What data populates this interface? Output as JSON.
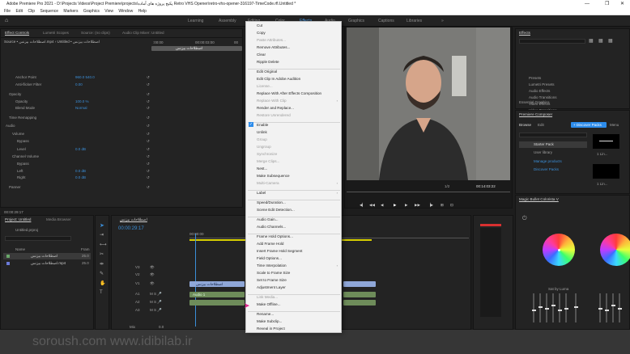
{
  "app": {
    "window_title": "Adobe Premiere Pro 2021 - D:\\Projects Videos\\Project Premiere\\projects\\پکیج پروژه های آماده Retro VHS Opener\\retro-vhs-opener-316197-TimeCode.rfl.Untitled *",
    "window_controls": [
      "—",
      "❐",
      "✕"
    ]
  },
  "menubar": [
    "File",
    "Edit",
    "Clip",
    "Sequence",
    "Markers",
    "Graphics",
    "View",
    "Window",
    "Help"
  ],
  "workspaces": [
    "Learning",
    "Assembly",
    "Editing",
    "Color",
    "Effects",
    "Audio",
    "Graphics",
    "Captions",
    "Libraries",
    "»"
  ],
  "effect_controls": {
    "tabs": [
      "Effect Controls",
      "Lumetri Scopes",
      "Source: (no clips)",
      "Audio Clip Mixer: Untitled"
    ],
    "source_line": "Source • اصطلاحات بیزنس.mp4  ›  Untitled • اصطلاحات بیزنس",
    "rows": [
      {
        "label": "Anchor Point",
        "value": "960.0    540.0"
      },
      {
        "label": "Anti-flicker Filter",
        "value": "0.00"
      },
      {
        "label": "Opacity",
        "value": ""
      },
      {
        "label": "Opacity",
        "value": "100.0 %"
      },
      {
        "label": "Blend Mode",
        "value": "Normal"
      },
      {
        "label": "Time Remapping",
        "value": ""
      },
      {
        "label": "Audio",
        "value": ""
      },
      {
        "label": "Volume",
        "value": ""
      },
      {
        "label": "Bypass",
        "value": ""
      },
      {
        "label": "Level",
        "value": "0.0 dB"
      },
      {
        "label": "Channel Volume",
        "value": ""
      },
      {
        "label": "Bypass",
        "value": ""
      },
      {
        "label": "Left",
        "value": "0.0 dB"
      },
      {
        "label": "Right",
        "value": "0.0 dB"
      },
      {
        "label": "Panner",
        "value": ""
      }
    ],
    "clip_label": "اصطلاحات بیزنس",
    "timecode": "00:00:29:17",
    "ruler_start": ":00:00",
    "ruler_mid": "00:00:03:00",
    "ruler_end": "00"
  },
  "program_monitor": {
    "timecode": "00:14:03:22",
    "fit": "1/2",
    "controls": [
      "◀▏",
      "◀◀",
      "◀",
      "▶",
      "▶",
      "▶▶",
      "▕▶",
      "⊞",
      "⊡",
      "📷",
      "⚙"
    ]
  },
  "context_menu": {
    "items": [
      {
        "label": "Cut",
        "disabled": false
      },
      {
        "label": "Copy",
        "disabled": false
      },
      {
        "label": "Paste Attributes...",
        "disabled": true
      },
      {
        "label": "Remove Attributes...",
        "disabled": false
      },
      {
        "label": "Clear",
        "disabled": false
      },
      {
        "label": "Ripple Delete",
        "disabled": false
      },
      {
        "sep": true
      },
      {
        "label": "Edit Original",
        "disabled": false
      },
      {
        "label": "Edit Clip In Adobe Audition",
        "disabled": false
      },
      {
        "label": "License...",
        "disabled": true
      },
      {
        "label": "Replace With After Effects Composition",
        "disabled": false
      },
      {
        "label": "Replace With Clip",
        "disabled": true,
        "submenu": true
      },
      {
        "label": "Render and Replace...",
        "disabled": false
      },
      {
        "label": "Restore Unrendered",
        "disabled": true
      },
      {
        "sep": true
      },
      {
        "label": "Enable",
        "disabled": false,
        "checked": true
      },
      {
        "label": "Unlink",
        "disabled": false
      },
      {
        "label": "Group",
        "disabled": true
      },
      {
        "label": "Ungroup",
        "disabled": true
      },
      {
        "label": "Synchronize",
        "disabled": true
      },
      {
        "label": "Merge Clips...",
        "disabled": true
      },
      {
        "label": "Nest...",
        "disabled": false
      },
      {
        "label": "Make Subsequence",
        "disabled": false
      },
      {
        "label": "Multi-Camera",
        "disabled": true,
        "submenu": true
      },
      {
        "sep": true
      },
      {
        "label": "Label",
        "disabled": false,
        "submenu": true
      },
      {
        "sep": true
      },
      {
        "label": "Speed/Duration...",
        "disabled": false
      },
      {
        "label": "Scene Edit Detection...",
        "disabled": false
      },
      {
        "sep": true
      },
      {
        "label": "Audio Gain...",
        "disabled": false
      },
      {
        "label": "Audio Channels...",
        "disabled": false
      },
      {
        "sep": true
      },
      {
        "label": "Frame Hold Options...",
        "disabled": false
      },
      {
        "label": "Add Frame Hold",
        "disabled": false
      },
      {
        "label": "Insert Frame Hold Segment",
        "disabled": false
      },
      {
        "label": "Field Options...",
        "disabled": false
      },
      {
        "label": "Time Interpolation",
        "disabled": false,
        "submenu": true
      },
      {
        "label": "Scale to Frame Size",
        "disabled": false
      },
      {
        "label": "Set to Frame Size",
        "disabled": false
      },
      {
        "label": "Adjustment Layer",
        "disabled": false
      },
      {
        "sep": true
      },
      {
        "label": "Link Media...",
        "disabled": true
      },
      {
        "label": "Make Offline...",
        "disabled": false
      },
      {
        "sep": true
      },
      {
        "label": "Rename...",
        "disabled": false
      },
      {
        "label": "Make Subclip...",
        "disabled": false
      },
      {
        "label": "Reveal in Project",
        "disabled": false
      }
    ]
  },
  "effects_panel": {
    "title": "Effects",
    "items": [
      "Presets",
      "Lumetri Presets",
      "Audio Effects",
      "Audio Transitions",
      "Video Effects",
      "Video Transitions"
    ],
    "footer": "Essential Graphics"
  },
  "premiere_composer": {
    "title": "Premiere Composer",
    "tabs": [
      "Browse",
      "Edit"
    ],
    "discover_button": "+ Discover Packs",
    "menu_label": "Menu",
    "tree": [
      "Starter Pack",
      "User library",
      "Manage products",
      "Discover Packs"
    ],
    "thumb_labels": [
      "1 Lin...",
      "1 Lin..."
    ]
  },
  "magic_bullet": {
    "title": "Magic Bullet Colorista V",
    "fader_label": "Sat by Luma"
  },
  "project_panel": {
    "tabs": [
      "Project: Untitled",
      "Media Browser"
    ],
    "project_file": "Untitled.prproj",
    "columns": [
      "Name",
      "Fram"
    ],
    "rows": [
      {
        "name": "اصطلاحات بیزنس",
        "fps": "25.0"
      },
      {
        "name": "اصطلاحات بیزنس.mp4",
        "fps": "25.0"
      }
    ]
  },
  "timeline": {
    "tab": "اصطلاحات بیزنس",
    "timecode": "00:00:29:17",
    "left_time": "00:00:00",
    "tracks": [
      "V3",
      "V2",
      "V1",
      "A1",
      "A2",
      "A3"
    ],
    "audio_label": "Audio 1",
    "clip_label": "اصطلاحات بیزنس",
    "master": "Mix",
    "master_value": "0.0"
  },
  "watermark": "soroush.com   www.idibilab.ir",
  "colors": {
    "accent": "#2d8ceb",
    "video_clip": "#8fa7d8",
    "audio_clip": "#6e8c5a",
    "menu_bg": "#f2f2f2",
    "playhead": "#3b8fd9"
  }
}
